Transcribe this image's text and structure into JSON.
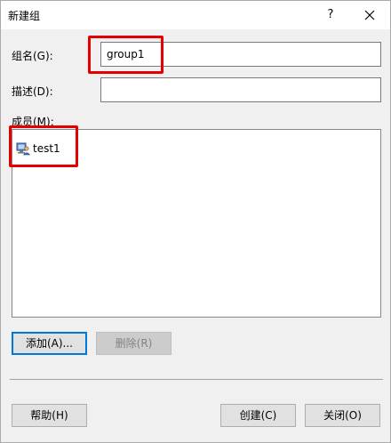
{
  "window": {
    "title": "新建组",
    "help_label": "?"
  },
  "form": {
    "name_label": "组名(G):",
    "name_value": "group1",
    "description_label": "描述(D):",
    "description_value": "",
    "members_label": "成员(M):"
  },
  "members": [
    {
      "name": "test1",
      "icon": "user-icon"
    }
  ],
  "buttons": {
    "add": "添加(A)...",
    "remove": "删除(R)",
    "help": "帮助(H)",
    "create": "创建(C)",
    "close": "关闭(O)"
  },
  "colors": {
    "annotation": "#e50000",
    "focus": "#0078d7"
  }
}
